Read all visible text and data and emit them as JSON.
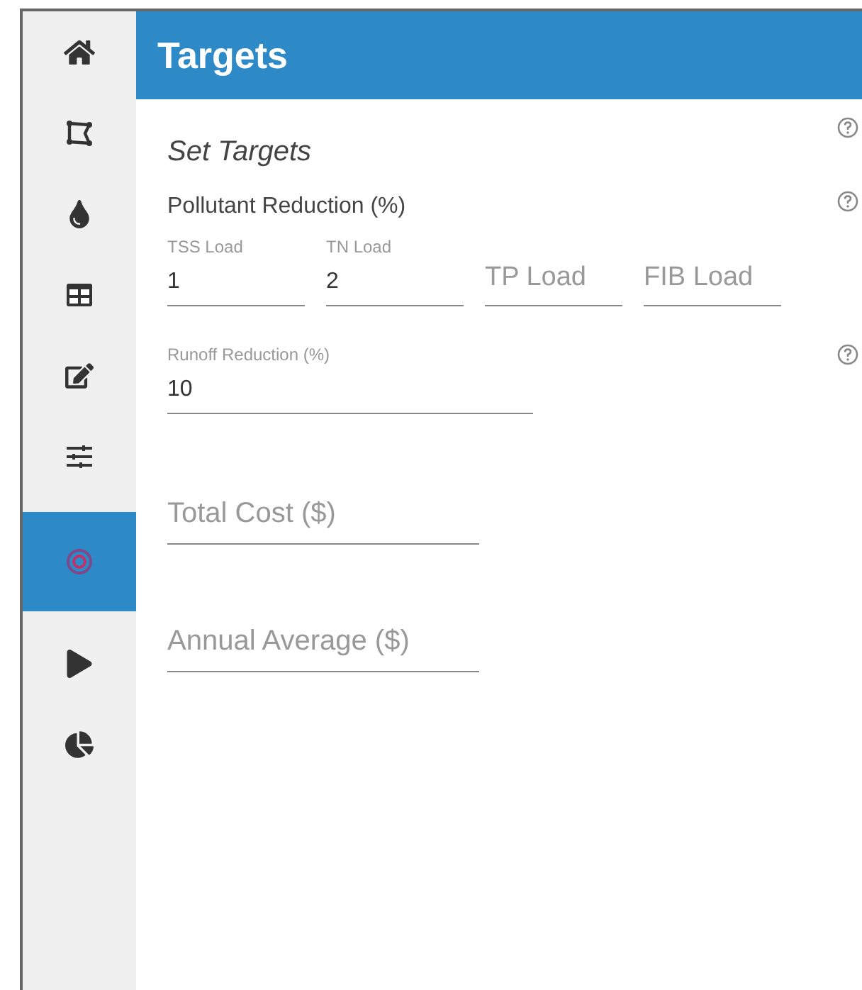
{
  "sidebar": {
    "items": [
      {
        "selected": false
      },
      {
        "selected": false
      },
      {
        "selected": false
      },
      {
        "selected": false
      },
      {
        "selected": false
      },
      {
        "selected": false
      },
      {
        "selected": true
      },
      {
        "selected": false
      },
      {
        "selected": false
      }
    ]
  },
  "header": {
    "title": "Targets"
  },
  "subtitle": "Set Targets",
  "pollutant": {
    "title": "Pollutant Reduction (%)",
    "fields": [
      {
        "label": "TSS Load",
        "value": "1"
      },
      {
        "label": "TN Load",
        "value": "2"
      },
      {
        "placeholder": "TP Load"
      },
      {
        "placeholder": "FIB Load"
      }
    ]
  },
  "runoff": {
    "label": "Runoff Reduction (%)",
    "value": "10"
  },
  "cost_fields": [
    {
      "placeholder": "Total Cost ($)"
    },
    {
      "placeholder": "Annual Average ($)"
    }
  ]
}
